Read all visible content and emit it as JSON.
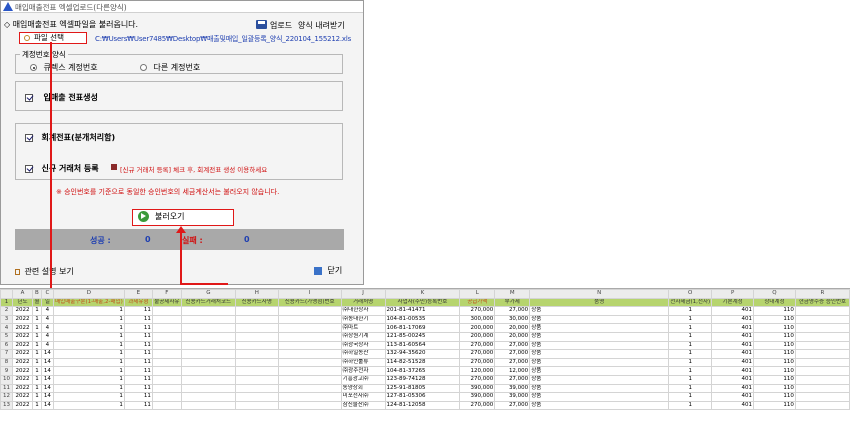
{
  "window": {
    "title": "매입매출전표 엑셀업로드(다른양식)"
  },
  "header": {
    "instruction": "◇ 매입매출전표 엑셀파일을 불러옵니다.",
    "upload_label": "업로드",
    "download_label": "양식 내려받기"
  },
  "file": {
    "select_label": "파일 선택",
    "path": "C:₩Users₩User7485₩Desktop₩매출및매입_일괄등록_양식_220104_155212.xls"
  },
  "account_group": {
    "legend": "계정번호 양식",
    "option1": "큐렉스 계정번호",
    "option2": "다른 계정번호",
    "selected": "option1"
  },
  "options": {
    "auto_create_label": "입매출 전표생성",
    "accounting_label": "회계전표(분개처리함)",
    "new_client_label": "신규 거래처 등록",
    "new_client_hint": "[신규 거래처 등록] 체크 후, 회계전표 생성 이용하세요",
    "note": "※ 승인번호를 기준으로 동일한 승인번호의 세금계산서는 불러오지 않습니다."
  },
  "actions": {
    "load_label": "불러오기",
    "help_label": "관련 설명 보기",
    "close_label": "닫기"
  },
  "status": {
    "success_label": "성공 :",
    "success_count": "0",
    "fail_label": "실패 :",
    "fail_count": "0"
  },
  "colors": {
    "accent_red": "#e01818",
    "header_green": "#b6d46e",
    "status_gray": "#a9a9a9"
  },
  "sheet": {
    "columns": [
      "",
      "A",
      "B",
      "C",
      "D",
      "E",
      "F",
      "G",
      "H",
      "I",
      "J",
      "K",
      "L",
      "M",
      "N",
      "O",
      "P",
      "Q",
      "R"
    ],
    "headers": [
      "1",
      "년도",
      "월",
      "일",
      "매입매출구분(1-매출,2-매입)",
      "과세유형",
      "불공제사유",
      "신용카드거래처코드",
      "신용카드사명",
      "신용카드(가맹점)번호",
      "거래처명",
      "사업자(주민)등록번호",
      "공급가액",
      "부가세",
      "품명",
      "전자세금(1,전자)",
      "기본계정",
      "상대계정",
      "현금영수증 승인번호"
    ],
    "rows": [
      [
        "2",
        "2022",
        "1",
        "4",
        "1",
        "11",
        "",
        "",
        "",
        "",
        "㈜대한상사",
        "201-81-41471",
        "270,000",
        "27,000",
        "상품",
        "1",
        "401",
        "110",
        ""
      ],
      [
        "3",
        "2022",
        "1",
        "4",
        "1",
        "11",
        "",
        "",
        "",
        "",
        "㈜동대한기",
        "104-81-00535",
        "300,000",
        "30,000",
        "상품",
        "1",
        "401",
        "110",
        ""
      ],
      [
        "4",
        "2022",
        "1",
        "4",
        "1",
        "11",
        "",
        "",
        "",
        "",
        "㈜마트",
        "106-81-17069",
        "200,000",
        "20,000",
        "상품",
        "1",
        "401",
        "110",
        ""
      ],
      [
        "5",
        "2022",
        "1",
        "4",
        "1",
        "11",
        "",
        "",
        "",
        "",
        "㈜상원기계",
        "121-85-00245",
        "200,000",
        "20,000",
        "상품",
        "1",
        "401",
        "110",
        ""
      ],
      [
        "6",
        "2022",
        "1",
        "4",
        "1",
        "11",
        "",
        "",
        "",
        "",
        "㈜광국상사",
        "113-81-60564",
        "270,000",
        "27,000",
        "상품",
        "1",
        "401",
        "110",
        ""
      ],
      [
        "7",
        "2022",
        "1",
        "14",
        "1",
        "11",
        "",
        "",
        "",
        "",
        "㈜하일농산",
        "132-94-35620",
        "270,000",
        "27,000",
        "상품",
        "1",
        "401",
        "110",
        ""
      ],
      [
        "8",
        "2022",
        "1",
        "14",
        "1",
        "11",
        "",
        "",
        "",
        "",
        "㈜하인툴류",
        "114-82-51528",
        "270,000",
        "27,000",
        "상품",
        "1",
        "401",
        "110",
        ""
      ],
      [
        "9",
        "2022",
        "1",
        "14",
        "1",
        "11",
        "",
        "",
        "",
        "",
        "㈜광주전자",
        "104-81-37265",
        "120,000",
        "12,000",
        "상품",
        "1",
        "401",
        "110",
        ""
      ],
      [
        "10",
        "2022",
        "1",
        "14",
        "1",
        "11",
        "",
        "",
        "",
        "",
        "기흥광고㈜",
        "123-89-74128",
        "270,000",
        "27,000",
        "상품",
        "1",
        "401",
        "110",
        ""
      ],
      [
        "11",
        "2022",
        "1",
        "14",
        "1",
        "11",
        "",
        "",
        "",
        "",
        "동양상회",
        "125-91-81805",
        "390,000",
        "39,000",
        "상품",
        "1",
        "401",
        "110",
        ""
      ],
      [
        "12",
        "2022",
        "1",
        "14",
        "1",
        "11",
        "",
        "",
        "",
        "",
        "미포전자㈜",
        "127-81-05306",
        "390,000",
        "39,000",
        "상품",
        "1",
        "401",
        "110",
        ""
      ],
      [
        "13",
        "2022",
        "1",
        "14",
        "1",
        "11",
        "",
        "",
        "",
        "",
        "삼신물산㈜",
        "124-81-12058",
        "270,000",
        "27,000",
        "상품",
        "1",
        "401",
        "110",
        ""
      ]
    ]
  }
}
